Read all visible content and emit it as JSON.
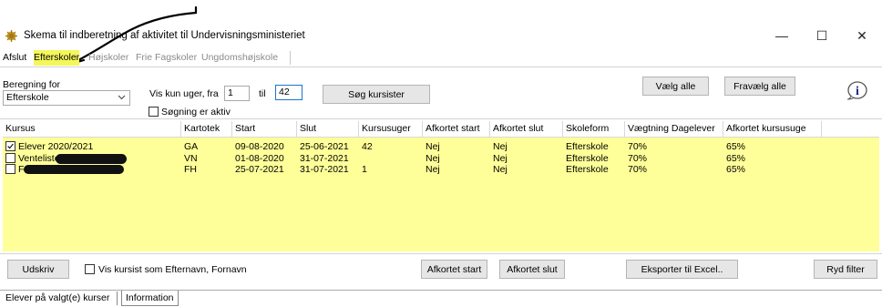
{
  "window": {
    "title": "Skema til indberetning af aktivitet til Undervisningsministeriet",
    "minimize": "—",
    "maximize": "☐",
    "close": "✕"
  },
  "menu": [
    {
      "label": "Afslut",
      "state": "normal"
    },
    {
      "label": "Efterskoler",
      "state": "active"
    },
    {
      "label": "Højskoler",
      "state": "disabled"
    },
    {
      "label": "Frie Fagskoler",
      "state": "disabled"
    },
    {
      "label": "Ungdomshøjskole",
      "state": "disabled"
    }
  ],
  "filters": {
    "beregning_label": "Beregning for",
    "beregning_value": "Efterskole",
    "vis_uger_label": "Vis kun uger, fra",
    "from_value": "1",
    "til_label": "til",
    "to_value": "42",
    "search_button": "Søg kursister",
    "soegning_label": "Søgning er aktiv",
    "select_all": "Vælg alle",
    "deselect_all": "Fravælg alle",
    "info_icon": "i"
  },
  "table": {
    "headers": [
      "Kursus",
      "Kartotek",
      "Start",
      "Slut",
      "Kursusuger",
      "Afkortet start",
      "Afkortet slut",
      "Skoleform",
      "Vægtning Dagelever",
      "Afkortet kursusuge"
    ],
    "rows": [
      {
        "checked": true,
        "kursus": "Elever 2020/2021",
        "kartotek": "GA",
        "start": "09-08-2020",
        "slut": "25-06-2021",
        "kursusuger": "42",
        "afk_start": "Nej",
        "afk_slut": "Nej",
        "skoleform": "Efterskole",
        "vaegtning": "70%",
        "afk_uge": "65%"
      },
      {
        "checked": false,
        "kursus": "Venteliste",
        "kartotek": "VN",
        "start": "01-08-2020",
        "slut": "31-07-2021",
        "kursusuger": "",
        "afk_start": "Nej",
        "afk_slut": "Nej",
        "skoleform": "Efterskole",
        "vaegtning": "70%",
        "afk_uge": "65%"
      },
      {
        "checked": false,
        "kursus": "F",
        "kartotek": "FH",
        "start": "25-07-2021",
        "slut": "31-07-2021",
        "kursusuger": "1",
        "afk_start": "Nej",
        "afk_slut": "Nej",
        "skoleform": "Efterskole",
        "vaegtning": "70%",
        "afk_uge": "65%"
      }
    ]
  },
  "bottom": {
    "print": "Udskriv",
    "show_lastname_first": "Vis kursist som Efternavn, Fornavn",
    "afkortet_start": "Afkortet start",
    "afkortet_slut": "Afkortet slut",
    "export": "Eksporter til Excel..",
    "clear_filter": "Ryd filter"
  },
  "tabs": [
    {
      "label": "Elever på valgt(e) kurser",
      "active": false
    },
    {
      "label": "Information",
      "active": true
    }
  ],
  "colors": {
    "grid_highlight": "#ffff99",
    "menu_highlight": "#f4f75a",
    "focus_border": "#1e74c9"
  }
}
